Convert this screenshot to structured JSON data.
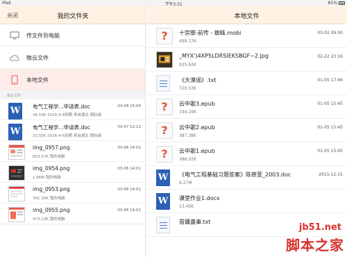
{
  "status_bar": {
    "device": "iPad",
    "time": "下午3:31",
    "battery": "81%"
  },
  "left_panel": {
    "close_label": "关闭",
    "title": "我的文件夹",
    "menu": [
      {
        "label": "传文件到电脑",
        "icon": "monitor-icon"
      },
      {
        "label": "微云文件",
        "icon": "cloud-icon"
      },
      {
        "label": "本地文件",
        "icon": "tablet-icon"
      }
    ],
    "section_label": "最近文件",
    "recent": [
      {
        "name": "电气工程学...申请表.doc",
        "date": "03-09 15:04",
        "meta": "26.50K 2016-4-8到期 来自湖北 周际城",
        "type": "word"
      },
      {
        "name": "电气工程学...申请表.doc",
        "date": "03-07 12:12",
        "meta": "33.50K 2016-4-6到期 来自湖北 周际城",
        "type": "word"
      },
      {
        "name": "img_0957.png",
        "date": "03-06 14:02",
        "meta": "823.57K 我的电脑",
        "type": "img"
      },
      {
        "name": "img_0954.png",
        "date": "03-06 14:01",
        "meta": "1.46M 我的电脑",
        "type": "img"
      },
      {
        "name": "img_0953.png",
        "date": "03-06 14:01",
        "meta": "391.16K 我的电脑",
        "type": "img"
      },
      {
        "name": "img_0955.png",
        "date": "03-06 14:01",
        "meta": "473.13K 我的电脑",
        "type": "img"
      }
    ]
  },
  "right_panel": {
    "title": "本地文件",
    "files": [
      {
        "name": "十宗罪-前传 - 蜘蛛.mobi",
        "date": "03-02 09:00",
        "size": "499.17K",
        "type": "unknown"
      },
      {
        "name": "_MYX')4XP5LDRSIEKSBGF~2.jpg",
        "date": "02-22 23:16",
        "size": "925.62K",
        "type": "photo"
      },
      {
        "name": "《大漠谣》.txt",
        "date": "01-05 17:46",
        "size": "720.53K",
        "type": "text"
      },
      {
        "name": "云中歌3.epub",
        "date": "01-05 15:45",
        "size": "194.29K",
        "type": "unknown"
      },
      {
        "name": "云中歌2.epub",
        "date": "01-05 15:45",
        "size": "387.38K",
        "type": "unknown"
      },
      {
        "name": "云中歌1.epub",
        "date": "01-05 15:45",
        "size": "388.02K",
        "type": "unknown"
      },
      {
        "name": "《电气工程基础习题答案》陈慈萱_2003.doc",
        "date": "2015-12-15",
        "size": "6.27M",
        "type": "word"
      },
      {
        "name": "课堂作业1.docx",
        "date": "",
        "size": "13.45K",
        "type": "word"
      },
      {
        "name": "苗疆蛊事.txt",
        "date": "",
        "size": "",
        "type": "text"
      }
    ]
  },
  "watermark": {
    "line1": "jb51.net",
    "line2": "脚本之家"
  }
}
